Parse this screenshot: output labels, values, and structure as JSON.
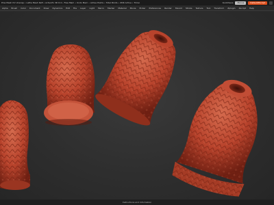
{
  "titlebar": {
    "title": "Pine Mesh UV Unwrap • Lathe Mesh Refl • ActiveTx 3D 6:4 • Free Mem • Undo Mem • Active Points • Total Points • ZDK Active • Timer",
    "quicksave_label": "QuickSave",
    "menus_label": "Menus",
    "default_script_label": "DefaultZScript"
  },
  "menubar": {
    "items": [
      "Alpha",
      "Brush",
      "Color",
      "Document",
      "Draw",
      "Dynamics",
      "Edit",
      "File",
      "Layer",
      "Light",
      "Macro",
      "Marker",
      "Material",
      "Movie",
      "Picker",
      "Preferences",
      "Render",
      "Stencil",
      "Stroke",
      "Texture",
      "Tool",
      "Transform",
      "Zplugin",
      "Zscript",
      "Help"
    ]
  },
  "viewport": {
    "background": "#2e2e2e",
    "model_color": "#b8432c",
    "objects": [
      "vase-left-partial",
      "vase-upright",
      "vase-tilted",
      "vase-right-large"
    ]
  },
  "statusbar": {
    "text": "Instructions and Information"
  },
  "colors": {
    "accent": "#e0501d",
    "model": "#b8432c",
    "model_dark": "#6e1f12",
    "model_light": "#d46a4d"
  }
}
